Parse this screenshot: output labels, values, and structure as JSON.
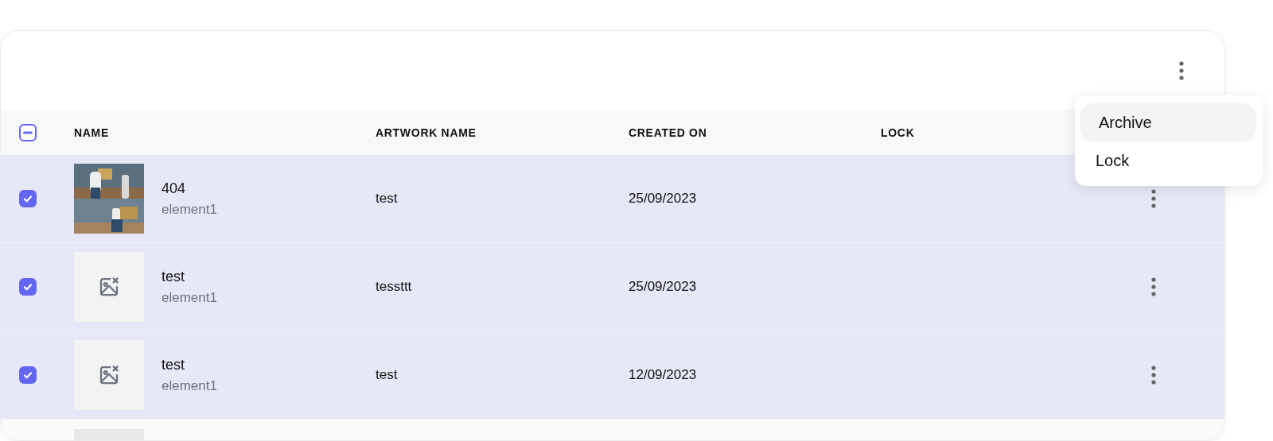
{
  "table": {
    "select_all": {
      "indeterminate": true
    },
    "columns": [
      "NAME",
      "ARTWORK NAME",
      "CREATED ON",
      "LOCK"
    ],
    "rows": [
      {
        "selected": true,
        "name": "404",
        "subtitle": "element1",
        "artwork_name": "test",
        "created_on": "25/09/2023"
      },
      {
        "selected": true,
        "thumbnail": {
          "kind": "placeholder"
        },
        "name": "test",
        "subtitle": "element1",
        "artwork_name": "tessttt",
        "created_on": "25/09/2023"
      },
      {
        "selected": true,
        "thumbnail": {
          "kind": "placeholder"
        },
        "name": "test",
        "subtitle": "element1",
        "artwork_name": "test",
        "created_on": "12/09/2023"
      }
    ]
  },
  "menu": {
    "items": [
      {
        "label": "Archive",
        "highlighted": true
      },
      {
        "label": "Lock",
        "highlighted": false
      }
    ]
  }
}
